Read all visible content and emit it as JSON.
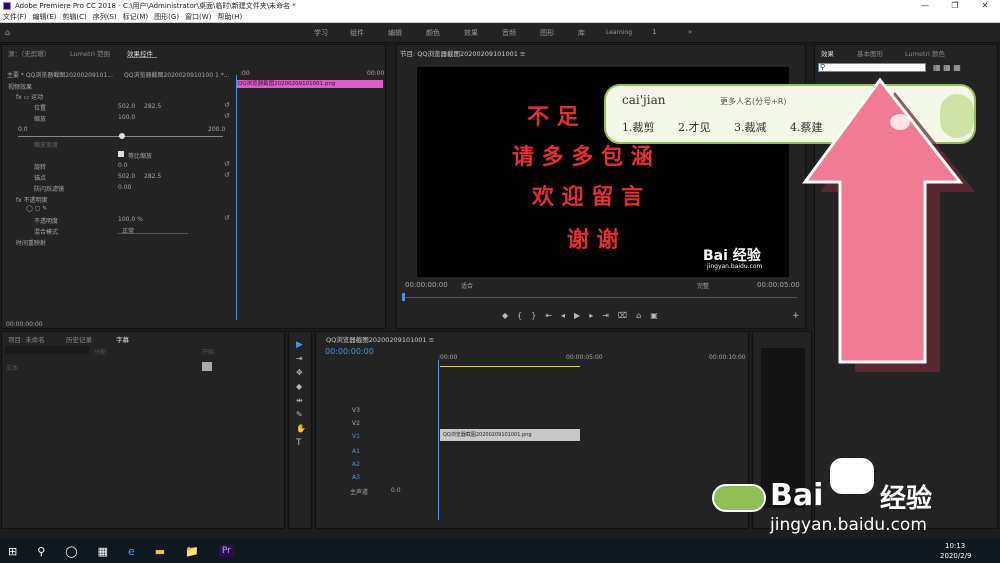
{
  "window": {
    "title": "Adobe Premiere Pro CC 2018 - C:\\用户\\Administrator\\桌面\\临时\\新建文件夹\\未命名 *",
    "min": "—",
    "max": "❐",
    "close": "✕"
  },
  "menu": [
    "文件(F)",
    "编辑(E)",
    "剪辑(C)",
    "序列(S)",
    "标记(M)",
    "图形(G)",
    "窗口(W)",
    "帮助(H)"
  ],
  "workspaces": [
    "学习",
    "组件",
    "编辑",
    "颜色",
    "效果",
    "音频",
    "图形",
    "库",
    "Learning"
  ],
  "workspace_num": "1",
  "workspace_more": "»",
  "source_panel": {
    "tabs": [
      "源：（无剪辑）",
      "Lumetri 范围",
      "效果控件"
    ],
    "master": "主要 * QQ浏览器截图20200209101...",
    "seq": "QQ浏览器截图2020020910100 1 *...",
    "clip": "QQ浏览器截图20200209101001.png",
    "ruler": [
      ":00",
      "00:00"
    ],
    "rows": [
      {
        "label": "视频效果",
        "val": "",
        "val2": ""
      },
      {
        "label": "fx  ▭  运动",
        "val": "",
        "val2": ""
      },
      {
        "label": "位置",
        "val": "502.0",
        "val2": "282.5"
      },
      {
        "label": "缩放",
        "val": "100.0",
        "val2": ""
      },
      {
        "label": "0.0",
        "val": "",
        "val2": "200.0"
      },
      {
        "label": "缩放宽度",
        "val": "",
        "val2": ""
      },
      {
        "label": "等比缩放",
        "val": "",
        "val2": ""
      },
      {
        "label": "旋转",
        "val": "0.0",
        "val2": ""
      },
      {
        "label": "锚点",
        "val": "502.0",
        "val2": "282.5"
      },
      {
        "label": "防闪烁滤镜",
        "val": "0.00",
        "val2": ""
      },
      {
        "label": "fx  不透明度",
        "val": "",
        "val2": ""
      },
      {
        "label": "◯ ▢ ✎",
        "val": "",
        "val2": ""
      },
      {
        "label": "不透明度",
        "val": "100.0 %",
        "val2": ""
      },
      {
        "label": "混合模式",
        "val": "正常",
        "val2": ""
      },
      {
        "label": "时间重映射",
        "val": "",
        "val2": ""
      }
    ],
    "timecode": "00:00:00:00"
  },
  "program": {
    "title": "节目: QQ浏览器截图20200209101001 ≡",
    "lines": [
      "不 足",
      "请 多 多 包 涵",
      "欢 迎 留 言",
      "谢 谢"
    ],
    "timecode": "00:00:00:00",
    "fit": "适合",
    "quality": "完整",
    "duration": "00:00:05:00",
    "watermark": "Bai 经验",
    "watermark_url": "jingyan.baidu.com"
  },
  "effects_panel": {
    "tabs": [
      "效果",
      "基本图形",
      "Lumetri 颜色"
    ]
  },
  "ime": {
    "input": "cai'jian",
    "more": "更多人名(分号+R)",
    "candidates": [
      "1.裁剪",
      "2.才见",
      "3.裁减",
      "4.蔡建"
    ]
  },
  "project_panel": {
    "tabs": [
      "项目: 未命名",
      "历史记录",
      "字幕"
    ],
    "search": "",
    "fields": [
      "分配",
      "文本",
      "开始"
    ]
  },
  "timeline": {
    "title": "QQ浏览器截图20200209101001 ≡",
    "timecode": "00:00:00:00",
    "ruler": [
      ":00:00",
      "00:00:05:00",
      "00:00:10:00"
    ],
    "tracks": [
      "V3",
      "V2",
      "V1",
      "A1",
      "A2",
      "A3",
      "主声道"
    ],
    "master_val": "0.0",
    "clip": "QQ浏览器截图20200209101001.png"
  },
  "tools": [
    "▶",
    "⇥",
    "✥",
    "◆",
    "⇹",
    "✎",
    "✋",
    "T"
  ],
  "taskbar": {
    "time": "10:13",
    "date": "2020/2/9",
    "apps": [
      "⊞",
      "⚲",
      "◯",
      "▦",
      "e",
      "▬",
      "📁",
      "Pr"
    ]
  },
  "baidu": {
    "brand": "Bai",
    "jy": "经验",
    "url": "jingyan.baidu.com"
  },
  "colors": {
    "accent": "#4f8fe0",
    "clip_pink": "#d760c8",
    "arrow": "#f07b92",
    "ime_green": "#8fbf57"
  }
}
